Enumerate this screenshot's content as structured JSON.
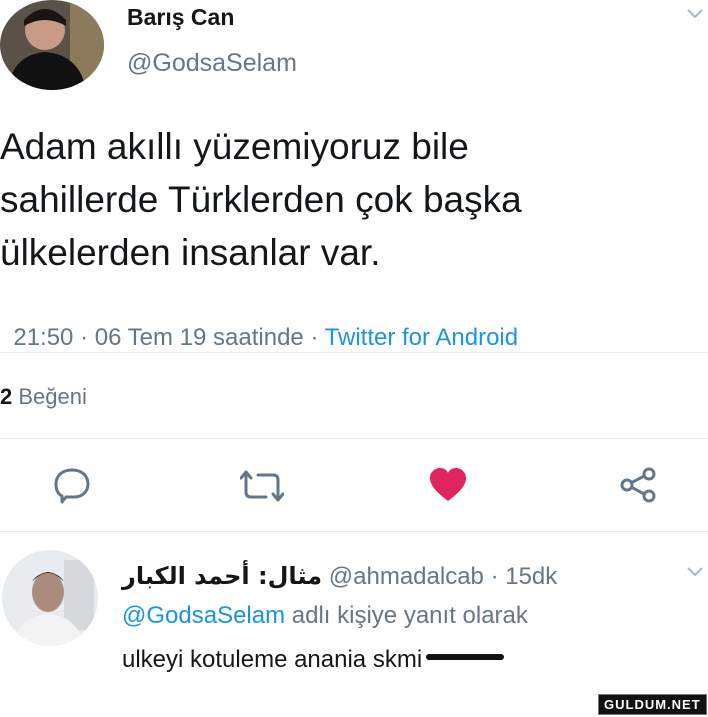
{
  "tweet": {
    "author": {
      "name": "Barış Can",
      "handle": "@GodsaSelam"
    },
    "text_lines": [
      "Adam akıllı yüzemiyoruz bile",
      "sahillerde Türklerden çok başka",
      "ülkelerden insanlar var."
    ],
    "timestamp": "21:50 · 06 Tem 19 saatinde · ",
    "source": "Twitter for Android",
    "likes": {
      "count": "2",
      "label": "Beğeni"
    },
    "actions": {
      "reply": "reply-icon",
      "retweet": "retweet-icon",
      "like": "heart-icon",
      "share": "share-icon"
    },
    "like_color": "#e0245e"
  },
  "reply": {
    "author_name": "مثال: أحمد الكبار",
    "handle": "@ahmadalcab",
    "age": "· 15dk",
    "in_reply_to_handle": "@GodsaSelam",
    "in_reply_to_suffix": "adlı kişiye yanıt olarak",
    "text": "ulkeyi kotuleme anania",
    "struck_text": "skmi"
  },
  "watermark": "GULDUM.NET"
}
